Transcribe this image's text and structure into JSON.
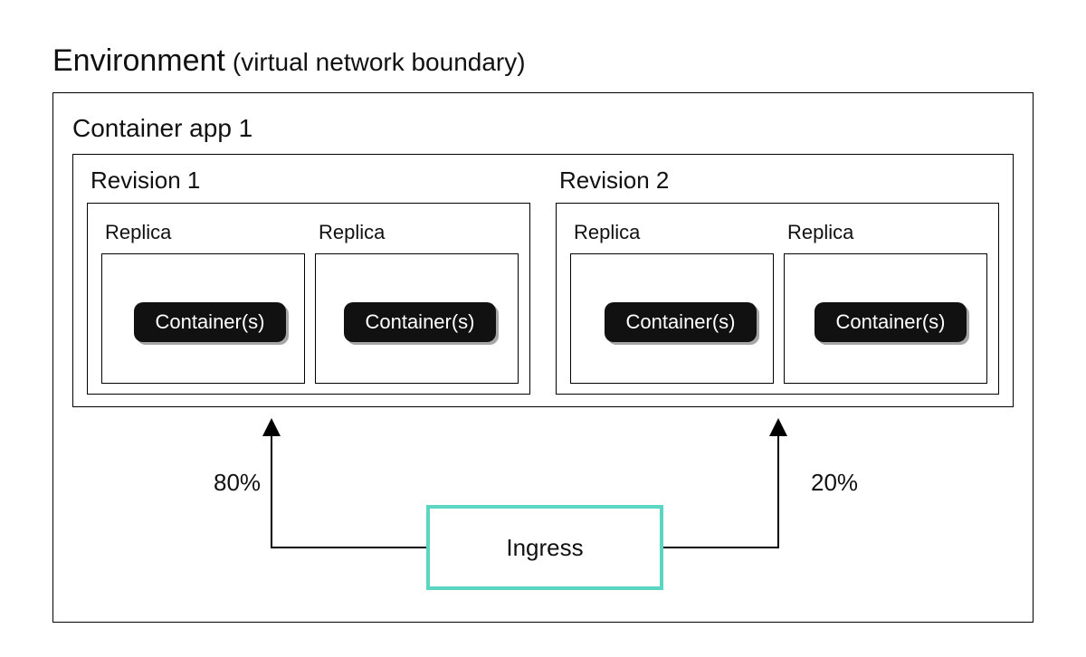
{
  "title": {
    "main": "Environment",
    "sub": "(virtual network boundary)"
  },
  "containerApp": {
    "label": "Container app 1",
    "revisions": [
      {
        "label": "Revision 1",
        "replicas": [
          {
            "label": "Replica",
            "container": "Container(s)"
          },
          {
            "label": "Replica",
            "container": "Container(s)"
          }
        ]
      },
      {
        "label": "Revision 2",
        "replicas": [
          {
            "label": "Replica",
            "container": "Container(s)"
          },
          {
            "label": "Replica",
            "container": "Container(s)"
          }
        ]
      }
    ]
  },
  "ingress": {
    "label": "Ingress",
    "split": [
      {
        "target": "Revision 1",
        "percent": "80%"
      },
      {
        "target": "Revision 2",
        "percent": "20%"
      }
    ]
  },
  "colors": {
    "ingressBorder": "#5bd6c2",
    "containerFill": "#111111"
  }
}
